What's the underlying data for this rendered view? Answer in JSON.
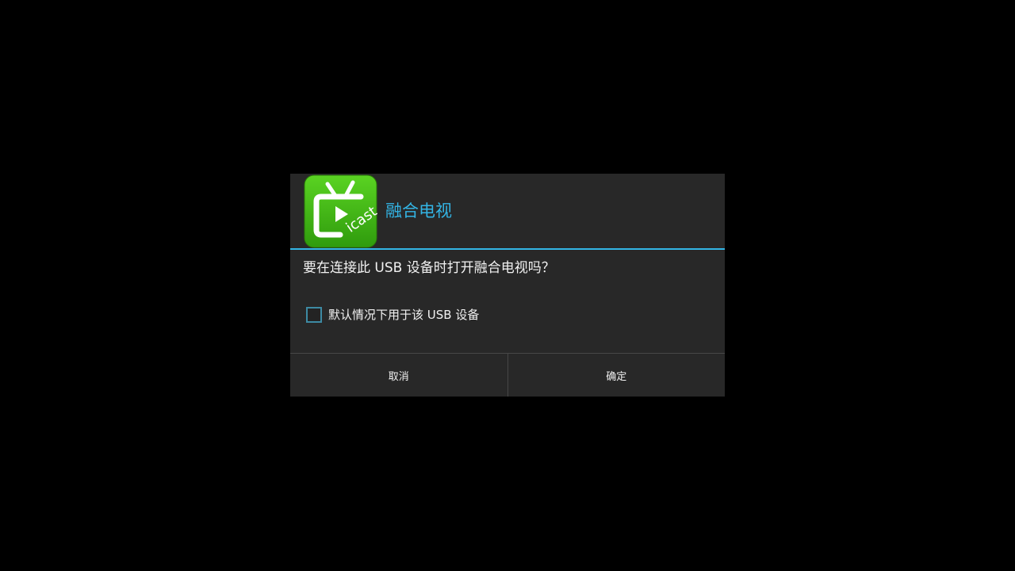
{
  "dialog": {
    "title": "融合电视",
    "message": "要在连接此 USB 设备时打开融合电视吗？",
    "checkbox_label": "默认情况下用于该 USB 设备",
    "checkbox_checked": false,
    "cancel_label": "取消",
    "ok_label": "确定",
    "app_icon": {
      "name": "icast-tv-icon",
      "text": "icast",
      "colors": {
        "gradient_top": "#5ad322",
        "gradient_bottom": "#2f9b0d"
      }
    }
  },
  "colors": {
    "background": "#000000",
    "dialog_bg": "#282828",
    "accent": "#33b5e5",
    "text": "#f2f2f2",
    "divider": "#474747"
  }
}
